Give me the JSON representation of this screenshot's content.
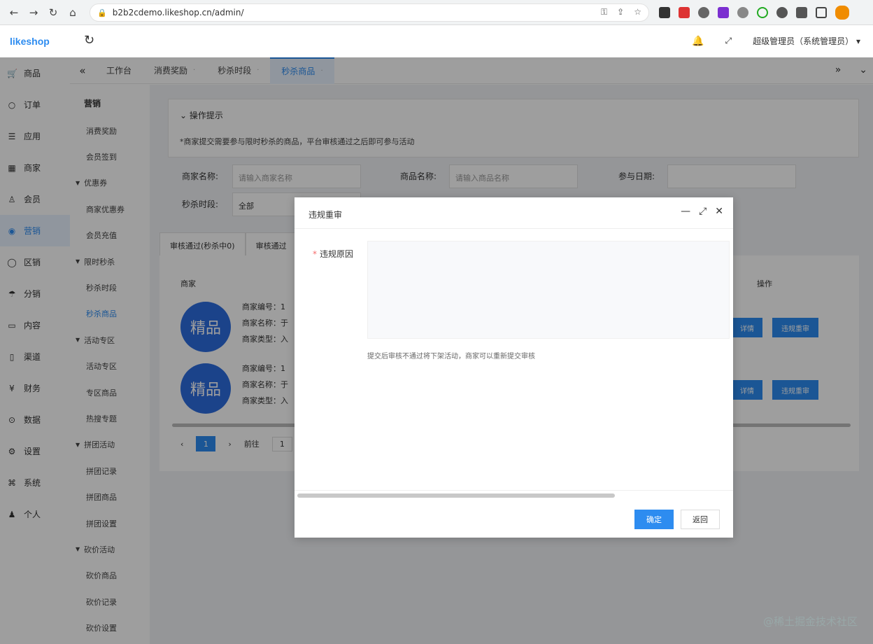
{
  "browser": {
    "url": "b2b2cdemo.likeshop.cn/admin/"
  },
  "app": {
    "logo": "likeshop",
    "user": "超级管理员（系统管理员）"
  },
  "sidebar": {
    "items": [
      {
        "label": "商品",
        "icon": "product-icon"
      },
      {
        "label": "订单",
        "icon": "order-icon"
      },
      {
        "label": "应用",
        "icon": "app-icon"
      },
      {
        "label": "商家",
        "icon": "shop-icon"
      },
      {
        "label": "会员",
        "icon": "member-icon"
      },
      {
        "label": "营销",
        "icon": "marketing-icon"
      },
      {
        "label": "区销",
        "icon": "circle-icon"
      },
      {
        "label": "分销",
        "icon": "distribution-icon"
      },
      {
        "label": "内容",
        "icon": "content-icon"
      },
      {
        "label": "渠道",
        "icon": "channel-icon"
      },
      {
        "label": "财务",
        "icon": "finance-icon"
      },
      {
        "label": "数据",
        "icon": "data-icon"
      },
      {
        "label": "设置",
        "icon": "settings-icon"
      },
      {
        "label": "系统",
        "icon": "system-icon"
      },
      {
        "label": "个人",
        "icon": "person-icon"
      }
    ],
    "active_index": 5
  },
  "subnav": {
    "title": "营销",
    "items": [
      {
        "label": "消费奖励",
        "type": "item"
      },
      {
        "label": "会员签到",
        "type": "item"
      },
      {
        "label": "优惠券",
        "type": "group"
      },
      {
        "label": "商家优惠券",
        "type": "item"
      },
      {
        "label": "会员充值",
        "type": "item"
      },
      {
        "label": "限时秒杀",
        "type": "group"
      },
      {
        "label": "秒杀时段",
        "type": "item"
      },
      {
        "label": "秒杀商品",
        "type": "item",
        "active": true
      },
      {
        "label": "活动专区",
        "type": "group"
      },
      {
        "label": "活动专区",
        "type": "item"
      },
      {
        "label": "专区商品",
        "type": "item"
      },
      {
        "label": "热搜专题",
        "type": "item"
      },
      {
        "label": "拼团活动",
        "type": "group"
      },
      {
        "label": "拼团记录",
        "type": "item"
      },
      {
        "label": "拼团商品",
        "type": "item"
      },
      {
        "label": "拼团设置",
        "type": "item"
      },
      {
        "label": "砍价活动",
        "type": "group"
      },
      {
        "label": "砍价商品",
        "type": "item"
      },
      {
        "label": "砍价记录",
        "type": "item"
      },
      {
        "label": "砍价设置",
        "type": "item"
      }
    ]
  },
  "tabs": [
    {
      "label": "工作台",
      "closable": false
    },
    {
      "label": "消费奖励",
      "closable": true
    },
    {
      "label": "秒杀时段",
      "closable": true
    },
    {
      "label": "秒杀商品",
      "closable": true,
      "active": true
    }
  ],
  "page": {
    "tip_title": "操作提示",
    "tip_text": "*商家提交需要参与限时秒杀的商品，平台审核通过之后即可参与活动",
    "filters": {
      "shop_name_label": "商家名称:",
      "shop_name_placeholder": "请输入商家名称",
      "goods_name_label": "商品名称:",
      "goods_name_placeholder": "请输入商品名称",
      "date_label": "参与日期:",
      "period_label": "秒杀时段:",
      "period_value": "全部"
    },
    "subtabs": [
      "审核通过(秒杀中0)",
      "审核通过"
    ],
    "table": {
      "col_shop": "商家",
      "col_action": "操作",
      "rows": [
        {
          "badge": "精品",
          "line1": "商家编号：1",
          "line2": "商家名称：于",
          "line3": "商家类型：入",
          "btn_a": "详情",
          "btn_b": "违规重审"
        },
        {
          "badge": "精品",
          "line1": "商家编号：1",
          "line2": "商家名称：于",
          "line3": "商家类型：入",
          "btn_a": "详情",
          "btn_b": "违规重审"
        }
      ]
    },
    "pager": {
      "prev": "‹",
      "page": "1",
      "next": "›",
      "goto_label": "前往",
      "goto_value": "1"
    }
  },
  "dialog": {
    "title": "违规重审",
    "field_label": "违规原因",
    "hint": "提交后审核不通过将下架活动，商家可以重新提交审核",
    "ok": "确定",
    "cancel": "返回"
  },
  "watermark": "@稀土掘金技术社区"
}
